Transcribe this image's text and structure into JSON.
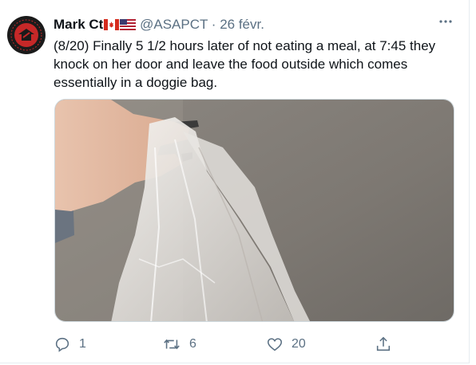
{
  "tweet": {
    "display_name": "Mark Ct",
    "handle": "@ASAPCT",
    "separator": "·",
    "date": "26 févr.",
    "text": "(8/20) Finally 5 1/2 hours later of not eating a meal, at 7:45 they knock on her door and leave the food outside which comes essentially in a doggie bag.",
    "avatar_text": "ANTIFASCISTE ACTION",
    "flags": [
      "canada-flag-icon",
      "usa-flag-icon"
    ],
    "media_description_icon": "hand-holding-plastic-bag-photo",
    "more_icon": "more-dots-icon"
  },
  "actions": {
    "reply_count": "1",
    "retweet_count": "6",
    "like_count": "20",
    "share_icon": "share-icon"
  },
  "colors": {
    "text_primary": "#0f1419",
    "text_secondary": "#5b7083",
    "avatar_red": "#c62828",
    "avatar_dark": "#1b1b1b"
  }
}
